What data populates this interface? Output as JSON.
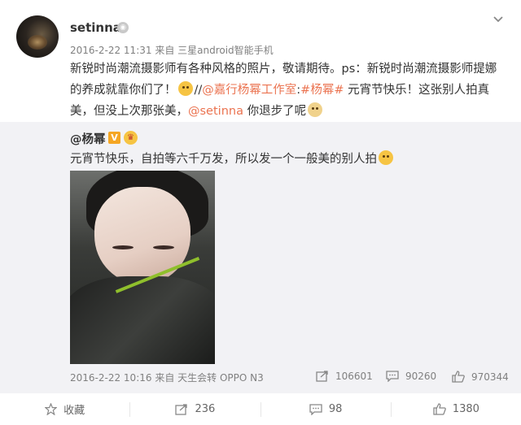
{
  "post": {
    "username": "setinna",
    "meta": "2016-2-22 11:31 来自 三星android智能手机",
    "text_segments": {
      "p1": "新锐时尚潮流摄影师有各种风格的照片，敬请期待。ps：新锐时尚潮流摄影师提娜的养成就靠你们了！",
      "slash": "//",
      "mention1": "@嘉行杨幂工作室",
      "colon": ":",
      "hashtag": "#杨幂#",
      "p2": " 元宵节快乐！这张别人拍真美，但没上次那张美，",
      "mention2": "@setinna",
      "p3": " 你退步了呢"
    },
    "icons": [
      "avatar",
      "user-badge-icon",
      "dropdown-chevron-icon",
      "smile-emoji",
      "cat-emoji"
    ]
  },
  "repost": {
    "username": "@杨幂",
    "verified_mark": "V",
    "text": "元宵节快乐，自拍等六千万发，所以发一个一般美的别人拍",
    "meta": "2016-2-22 10:16 来自 天生会转 OPPO N3",
    "reposts": "106601",
    "comments": "90260",
    "likes": "970344"
  },
  "actions": {
    "favorite": "收藏",
    "repost": "236",
    "comment": "98",
    "like": "1380"
  },
  "colors": {
    "accent_link": "#eb7350",
    "repost_bg": "#f2f2f5",
    "verified": "#f5a623"
  }
}
